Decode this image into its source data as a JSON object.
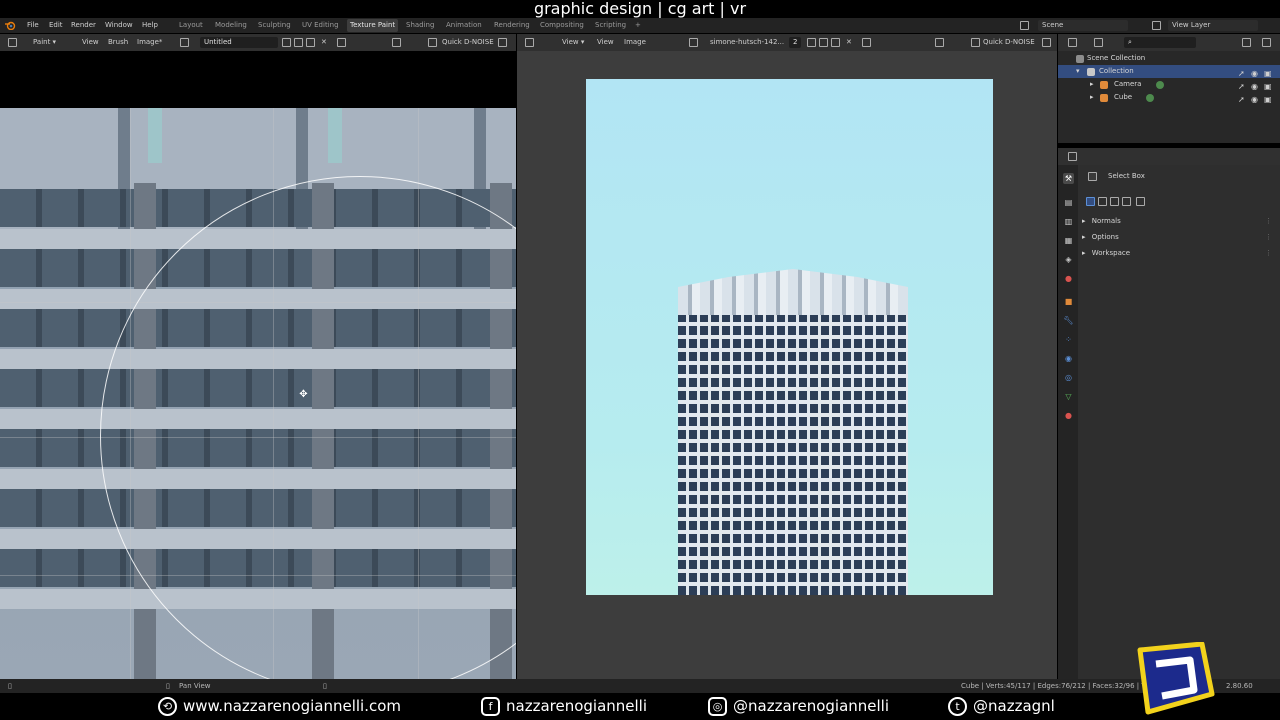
{
  "overlay": {
    "title": "graphic design | cg art | vr"
  },
  "topbar": {
    "menus": [
      "File",
      "Edit",
      "Render",
      "Window",
      "Help"
    ],
    "workspaces": [
      "Layout",
      "Modeling",
      "Sculpting",
      "UV Editing",
      "Texture Paint",
      "Shading",
      "Animation",
      "Rendering",
      "Compositing",
      "Scripting"
    ],
    "active_workspace": "Texture Paint",
    "add_tab": "+",
    "scene": "Scene",
    "view_layer": "View Layer"
  },
  "left_header": {
    "mode": "Paint",
    "menus": [
      "View",
      "Brush",
      "Image*"
    ],
    "image_name": "Untitled",
    "denoise": "Quick D-NOISE"
  },
  "right_header": {
    "menus": [
      "View",
      "View",
      "Image"
    ],
    "image_name": "simone-hutsch-142...",
    "users": "2",
    "denoise": "Quick D-NOISE"
  },
  "outliner": {
    "search_placeholder": "",
    "items": [
      {
        "label": "Scene Collection"
      },
      {
        "label": "Collection"
      },
      {
        "label": "Camera"
      },
      {
        "label": "Cube"
      }
    ]
  },
  "properties": {
    "tool_name": "Select Box",
    "panels": [
      "Normals",
      "Options",
      "Workspace"
    ]
  },
  "statusbar": {
    "left_hint": "Pan View",
    "stats": "Cube | Verts:45/117 | Edges:76/212 | Faces:32/96 | T",
    "version": "2.80.60"
  },
  "banner": {
    "website": "www.nazzarenogiannelli.com",
    "facebook": "nazzarenogiannelli",
    "instagram": "@nazzarenogiannelli",
    "twitter": "@nazzagnl"
  },
  "colors": {
    "accent": "#334d80",
    "brand_yellow": "#f2d21c",
    "brand_blue": "#1c2a8c",
    "sky": "#b2e5f4"
  }
}
